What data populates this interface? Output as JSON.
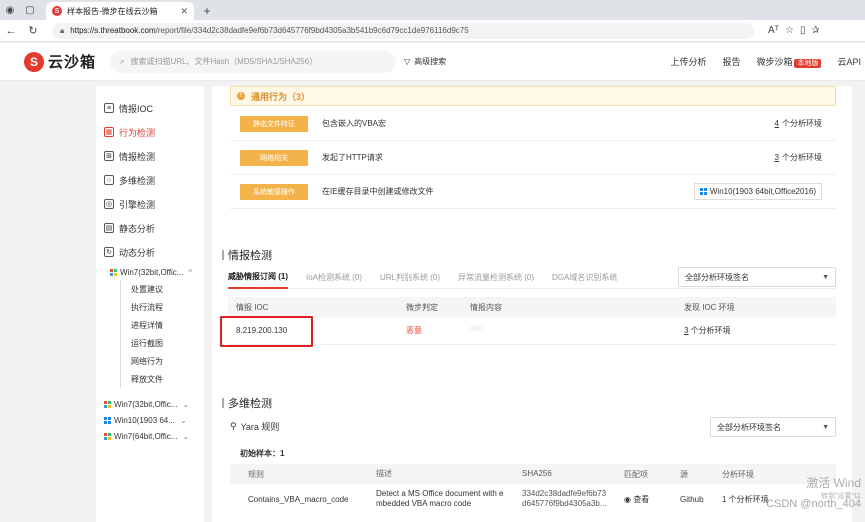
{
  "browser": {
    "tab_title": "样本报告-微步在线云沙箱",
    "url_host": "https://s.threatbook.com",
    "url_path": "/report/file/334d2c38dadfe9ef6b73d645776f9bd4305a3b541b9c6d79cc1de976116d9c75",
    "reader_label": "Aᵀ"
  },
  "header": {
    "logo_text": "云沙箱",
    "search_placeholder": "搜索或扫描URL、文件Hash（MD5/SHA1/SHA256）",
    "advanced_search": "高级搜索",
    "nav": {
      "upload": "上传分析",
      "report": "报告",
      "sandbox": "微步沙箱",
      "badge": "本地版",
      "api": "云API"
    }
  },
  "sidebar": {
    "items": [
      {
        "label": "情报IOC",
        "icon": "document-icon"
      },
      {
        "label": "行为检测",
        "icon": "image-icon",
        "active": true
      },
      {
        "label": "情报检测",
        "icon": "grid-icon"
      },
      {
        "label": "多维检测",
        "icon": "search-icon"
      },
      {
        "label": "引擎检测",
        "icon": "engine-icon"
      },
      {
        "label": "静态分析",
        "icon": "file-icon"
      },
      {
        "label": "动态分析",
        "icon": "refresh-icon"
      }
    ],
    "env_expanded": "Win7(32bit,Offic...",
    "sub_items": [
      "处置建议",
      "执行流程",
      "进程详情",
      "运行截图",
      "网络行为",
      "释放文件"
    ],
    "envs": [
      "Win7(32bit,Offic...",
      "Win10(1903 64...",
      "Win7(64bit,Offic..."
    ]
  },
  "behavior": {
    "title": "通用行为（3）",
    "rows": [
      {
        "tag": "静态文件特征",
        "desc": "包含嵌入的VBA宏",
        "count": "4",
        "suffix": " 个分析环境"
      },
      {
        "tag": "网络相关",
        "desc": "发起了HTTP请求",
        "count": "3",
        "suffix": " 个分析环境"
      },
      {
        "tag": "系统敏感操作",
        "desc": "在IE缓存目录中创建或修改文件",
        "env": "Win10(1903 64bit,Office2016)"
      }
    ]
  },
  "intel": {
    "title": "情报检测",
    "tabs": [
      "威胁情报订阅 (1)",
      "IoA检测系统 (0)",
      "URL判别系统 (0)",
      "异常流量检测系统 (0)",
      "DGA域名识别系统"
    ],
    "select": "全部分析环境签名",
    "columns": [
      "情报 IOC",
      "微步判定",
      "情报内容",
      "发现 IOC 环境"
    ],
    "rows": [
      {
        "ioc": "8.219.200.130",
        "verdict": "恶意",
        "content": "****",
        "count": "3",
        "suffix": " 个分析环境"
      }
    ]
  },
  "multi": {
    "title": "多维检测",
    "yara_label": "Yara 规则",
    "select": "全部分析环境签名",
    "initial": "初始样本：1",
    "columns": [
      "规则",
      "描述",
      "SHA256",
      "匹配项",
      "源",
      "分析环境"
    ],
    "rows": [
      {
        "rule": "Contains_VBA_macro_code",
        "desc1": "Detect a MS Office document with e",
        "desc2": "mbedded VBA macro code",
        "sha1": "334d2c38dadfe9ef6b73",
        "sha2": "d645776f9bd4305a3b...",
        "match": "查看",
        "source": "Github",
        "env": "1 个分析环境"
      }
    ]
  },
  "overlay": {
    "activate1": "激活 Wind",
    "activate2": "转到\"设置\"以",
    "csdn": "CSDN @north_404"
  },
  "colors": {
    "brand": "#e23b2e",
    "tag": "#f4b34a",
    "highlight": "#e02020"
  }
}
